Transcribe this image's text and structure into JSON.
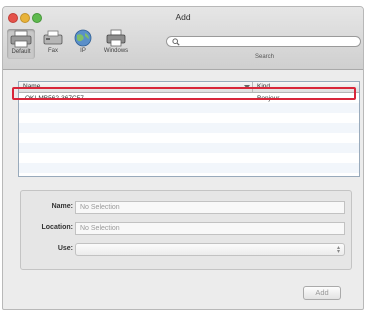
{
  "window": {
    "title": "Add"
  },
  "toolbar": {
    "items": [
      {
        "label": "Default",
        "icon": "printer-icon",
        "selected": true
      },
      {
        "label": "Fax",
        "icon": "fax-icon"
      },
      {
        "label": "IP",
        "icon": "globe-icon"
      },
      {
        "label": "Windows",
        "icon": "windows-printer-icon"
      }
    ],
    "search": {
      "placeholder": "",
      "label": "Search"
    }
  },
  "printer_list": {
    "columns": [
      "Name",
      "Kind"
    ],
    "rows": [
      {
        "name": "OKI-MB562-367C57",
        "kind": "Bonjour",
        "selected": true
      }
    ],
    "highlight_color": "#d8263a"
  },
  "details": {
    "name_label": "Name:",
    "name_value": "No Selection",
    "location_label": "Location:",
    "location_value": "No Selection",
    "use_label": "Use:",
    "use_value": ""
  },
  "footer": {
    "add_label": "Add",
    "add_enabled": false
  }
}
